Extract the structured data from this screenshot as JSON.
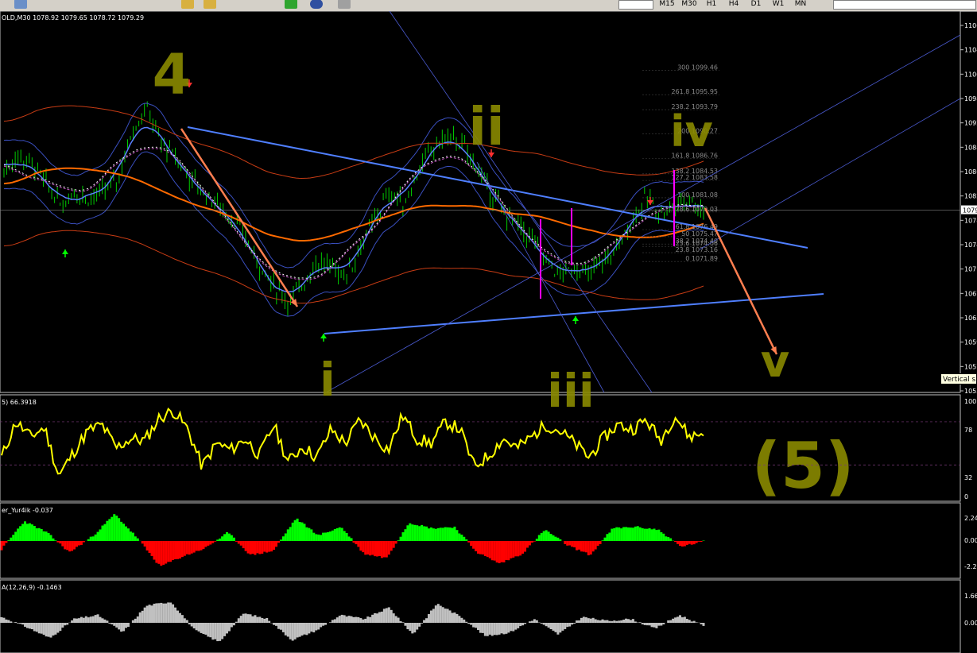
{
  "toolbar": {
    "timeframes": [
      "M15",
      "M30",
      "H1",
      "H4",
      "D1",
      "W1",
      "MN"
    ]
  },
  "price_chart": {
    "header": "OLD,M30  1078.92 1079.65 1078.72 1079.29",
    "axis_ticks": [
      "1106",
      "1104",
      "1100",
      "1098",
      "1092",
      "1088",
      "1086",
      "1082",
      "1078",
      "1074",
      "1071",
      "1067",
      "1063",
      "1059",
      "1057",
      "1053"
    ],
    "current_price_label": "1079",
    "tooltip": "Vertical s",
    "fib_levels": [
      {
        "label": "300 1099.46",
        "price": 1099.46
      },
      {
        "label": "261.8 1095.95",
        "price": 1095.95
      },
      {
        "label": "238.2 1093.79",
        "price": 1093.79
      },
      {
        "label": "200 1090.27",
        "price": 1090.27
      },
      {
        "label": "161.8 1086.76",
        "price": 1086.76
      },
      {
        "label": "138.2 1084.53",
        "price": 1084.53
      },
      {
        "label": "127.2 1083.58",
        "price": 1083.58
      },
      {
        "label": "100 1081.08",
        "price": 1081.08
      },
      {
        "label": "78.6 1079.03",
        "price": 1079.03
      },
      {
        "label": "61.8 1076.49",
        "price": 1076.49
      },
      {
        "label": "50 1075.47",
        "price": 1075.47
      },
      {
        "label": "38.2 1074.40",
        "price": 1074.4
      },
      {
        "label": "23.6 1074.06",
        "price": 1074.06
      },
      {
        "label": "23.8 1073.16",
        "price": 1073.16
      },
      {
        "label": "0 1071.89",
        "price": 1071.89
      }
    ],
    "wave_labels": [
      "4",
      "i",
      "ii",
      "iii",
      "iv",
      "v",
      "(5)"
    ]
  },
  "rsi_panel": {
    "header": "5) 66.3918",
    "levels": [
      "100",
      "78",
      "32",
      "0"
    ]
  },
  "osc_panel": {
    "header": "er_Yur4ik -0.037",
    "levels": [
      "2.24",
      "0.00",
      "-2.26"
    ]
  },
  "macd_panel": {
    "header": "A(12,26,9) -0.1463",
    "levels": [
      "1.66",
      "0.00"
    ]
  },
  "colors": {
    "background": "#000000",
    "bull_candle": "#00cc00",
    "rsi_line": "#ffff00",
    "osc_positive": "#00ff00",
    "osc_negative": "#ff0000",
    "macd_histogram": "#c0c0c0",
    "trendline": "#4f7fff",
    "moving_average": "#ff6a00",
    "annotation": "#8a8a00",
    "forecast_arrow": "#ff7f50",
    "magenta_marker": "#ff00ff"
  },
  "chart_data": [
    {
      "type": "candlestick",
      "symbol_timeframe": "OLD,M30",
      "ohlc_last": {
        "open": 1078.92,
        "high": 1079.65,
        "low": 1078.72,
        "close": 1079.29
      },
      "ylim": [
        1053,
        1108
      ],
      "close_path": [
        1085,
        1087,
        1086,
        1083,
        1080,
        1082,
        1081,
        1082,
        1084,
        1091,
        1094,
        1089,
        1087,
        1084,
        1082,
        1080,
        1078,
        1075,
        1071,
        1068,
        1066,
        1069,
        1072,
        1071,
        1070,
        1074,
        1078,
        1082,
        1080,
        1085,
        1088,
        1090,
        1089,
        1086,
        1082,
        1079,
        1077,
        1075,
        1072,
        1070,
        1071,
        1070,
        1072,
        1074,
        1078,
        1081,
        1079,
        1080,
        1081,
        1079
      ]
    },
    {
      "type": "line",
      "name": "RSI",
      "value_last": 66.3918,
      "ylim": [
        0,
        100
      ],
      "values": [
        40,
        78,
        62,
        72,
        20,
        45,
        68,
        75,
        50,
        60,
        58,
        82,
        90,
        70,
        30,
        55,
        48,
        60,
        42,
        75,
        35,
        52,
        40,
        70,
        55,
        80,
        62,
        48,
        85,
        60,
        55,
        78,
        70,
        30,
        42,
        60,
        50,
        62,
        75,
        68,
        55,
        40,
        60,
        75,
        70,
        80,
        58,
        85,
        62,
        66
      ]
    },
    {
      "type": "bar",
      "name": "er_Yur4ik",
      "value_last": -0.037,
      "ylim": [
        -2.26,
        2.24
      ],
      "values": [
        -0.6,
        1.4,
        0.6,
        -0.8,
        0.3,
        1.9,
        0.2,
        -1.8,
        -1.1,
        -0.5,
        0.6,
        -1.0,
        -0.7,
        1.6,
        0.4,
        1.0,
        -0.9,
        -1.2,
        1.3,
        0.9,
        1.0,
        -0.8,
        -1.6,
        -0.9,
        0.8,
        -0.3,
        -1.0,
        0.9,
        1.0,
        0.8,
        -0.4,
        -0.037
      ]
    },
    {
      "type": "bar",
      "name": "MACD(12,26,9)",
      "value_last": -0.1463,
      "ylim": [
        -1.2,
        1.66
      ],
      "values": [
        0.3,
        -0.2,
        -0.8,
        0.2,
        0.4,
        -0.5,
        0.9,
        1.1,
        -0.4,
        -1.0,
        0.5,
        0.2,
        -0.9,
        -0.4,
        0.4,
        0.2,
        0.8,
        -0.6,
        1.0,
        0.3,
        -0.7,
        -0.5,
        0.2,
        -0.6,
        0.3,
        0.1,
        0.2,
        -0.3,
        0.4,
        -0.1463
      ]
    }
  ]
}
